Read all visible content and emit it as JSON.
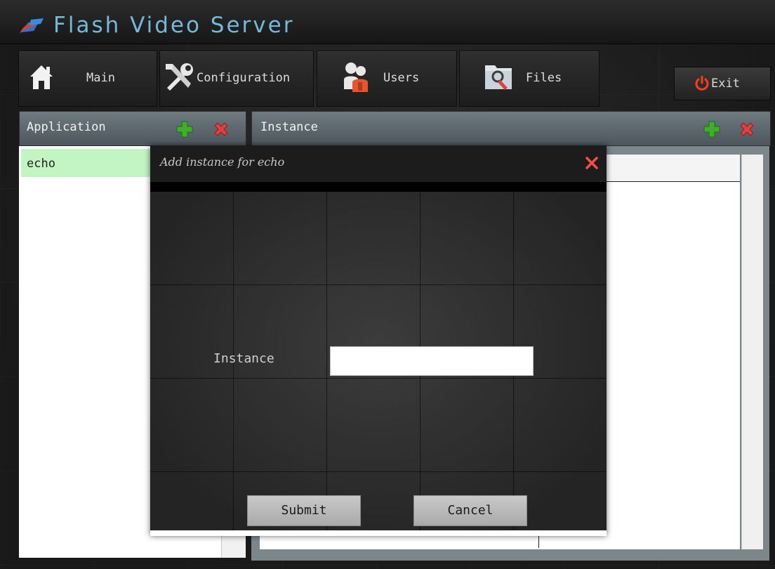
{
  "app": {
    "title": "Flash Video Server"
  },
  "nav": {
    "items": [
      {
        "label": "Main",
        "icon": "home-icon"
      },
      {
        "label": "Configuration",
        "icon": "tools-icon"
      },
      {
        "label": "Users",
        "icon": "users-icon"
      },
      {
        "label": "Files",
        "icon": "files-icon"
      }
    ],
    "exit": {
      "label": "Exit",
      "icon": "power-icon"
    }
  },
  "application_panel": {
    "header": "Application",
    "items": [
      {
        "label": "echo",
        "selected": true
      }
    ]
  },
  "instance_panel": {
    "header": "Instance"
  },
  "modal": {
    "title": "Add instance for echo",
    "field_label": "Instance",
    "field_value": "",
    "submit_label": "Submit",
    "cancel_label": "Cancel"
  },
  "colors": {
    "title_text": "#74b9d8",
    "panel_header": "#5e686e",
    "selected_row": "#c3f5c3",
    "add_icon": "#3fae2a",
    "delete_icon": "#e04040",
    "exit_icon": "#ff3a1a"
  }
}
